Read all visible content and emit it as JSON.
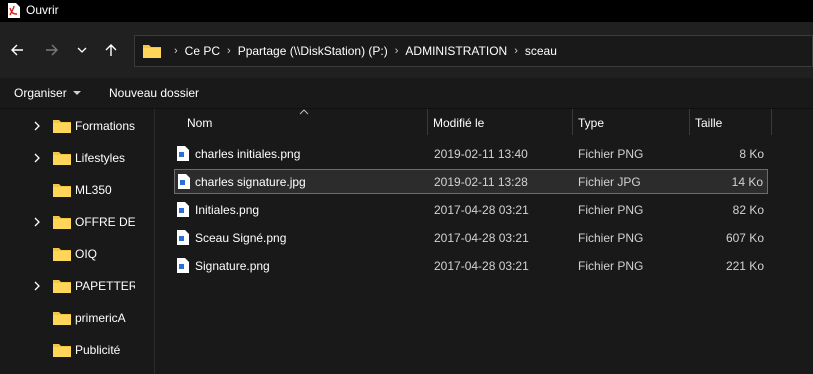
{
  "window": {
    "title": "Ouvrir"
  },
  "navigation": {
    "breadcrumb": [
      "Ce PC",
      "Ppartage (\\\\DiskStation) (P:)",
      "ADMINISTRATION",
      "sceau"
    ]
  },
  "commands": {
    "organise": "Organiser",
    "new_folder": "Nouveau dossier"
  },
  "sidebar": {
    "items": [
      {
        "label": "Formations",
        "expandable": true
      },
      {
        "label": "Lifestyles",
        "expandable": true
      },
      {
        "label": "ML350",
        "expandable": false
      },
      {
        "label": "OFFRE DE S",
        "expandable": true
      },
      {
        "label": "OIQ",
        "expandable": false
      },
      {
        "label": "PAPETTERIE",
        "expandable": true
      },
      {
        "label": "primericA",
        "expandable": false
      },
      {
        "label": "Publicité",
        "expandable": false
      }
    ]
  },
  "files": {
    "columns": {
      "name": "Nom",
      "modified": "Modifié le",
      "type": "Type",
      "size": "Taille"
    },
    "rows": [
      {
        "name": "charles initiales.png",
        "modified": "2019-02-11 13:40",
        "type": "Fichier PNG",
        "size": "8 Ko",
        "selected": false
      },
      {
        "name": "charles signature.jpg",
        "modified": "2019-02-11 13:28",
        "type": "Fichier JPG",
        "size": "14 Ko",
        "selected": true
      },
      {
        "name": "Initiales.png",
        "modified": "2017-04-28 03:21",
        "type": "Fichier PNG",
        "size": "82 Ko",
        "selected": false
      },
      {
        "name": "Sceau Signé.png",
        "modified": "2017-04-28 03:21",
        "type": "Fichier PNG",
        "size": "607 Ko",
        "selected": false
      },
      {
        "name": "Signature.png",
        "modified": "2017-04-28 03:21",
        "type": "Fichier PNG",
        "size": "221 Ko",
        "selected": false
      }
    ]
  },
  "colors": {
    "folder": "#f4c542",
    "background": "#191919",
    "navbar": "#202020",
    "selection": "#2c2c2c"
  }
}
